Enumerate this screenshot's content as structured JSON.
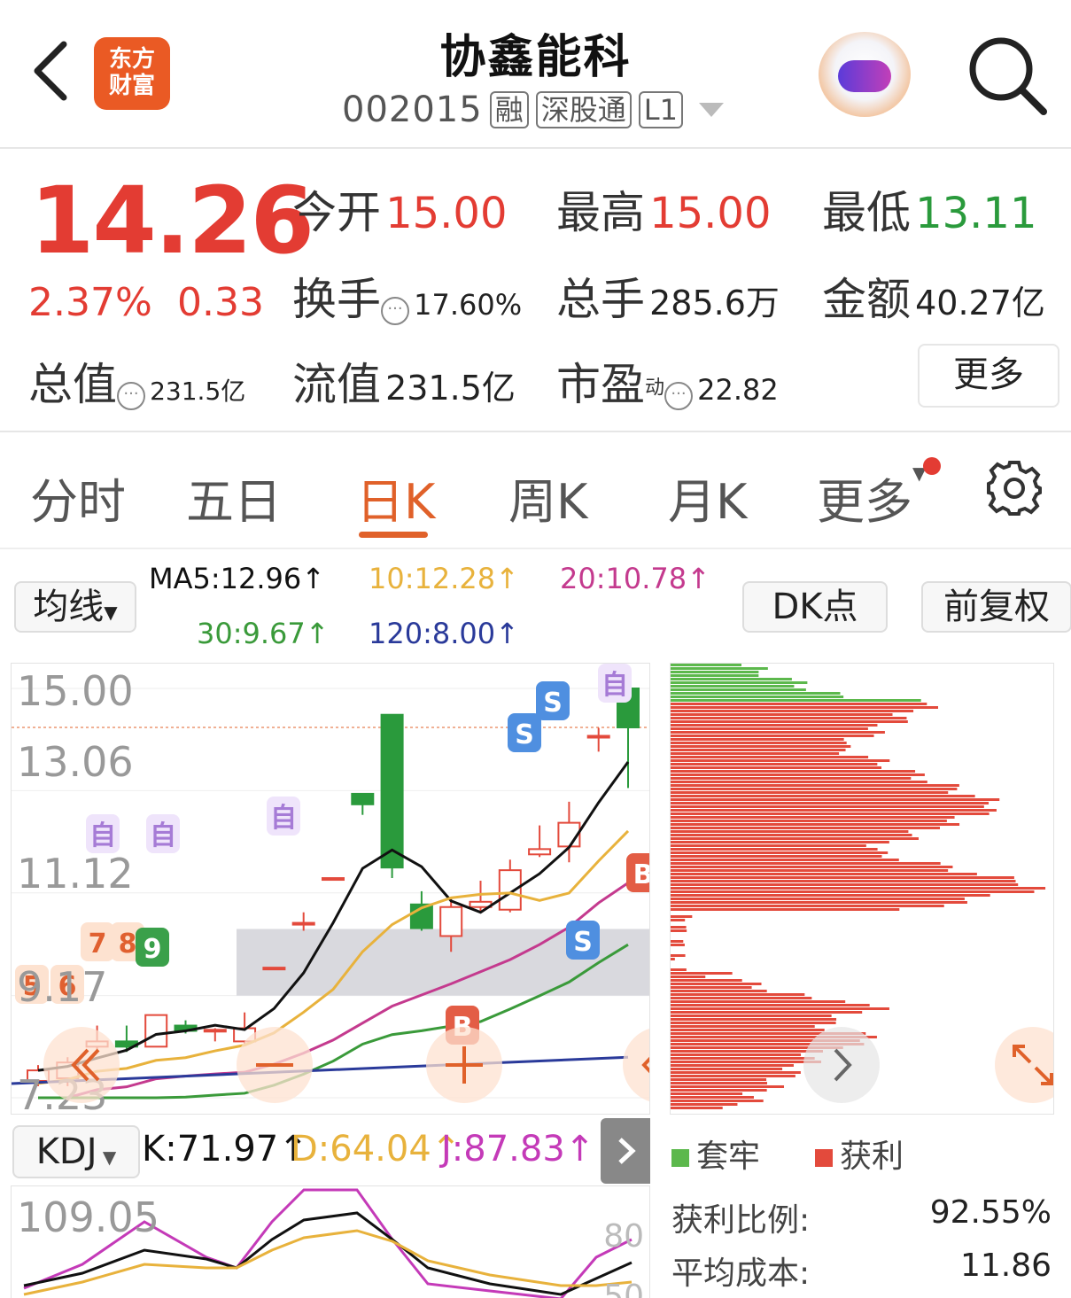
{
  "header": {
    "logo_text_line1": "东方",
    "logo_text_line2": "财富",
    "stock_name": "协鑫能科",
    "stock_code": "002015",
    "tags": [
      "融",
      "深股通",
      "L1"
    ],
    "icons": [
      "back-arrow-icon",
      "app-logo",
      "robot-assistant-icon",
      "search-icon"
    ]
  },
  "quote": {
    "price": "14.26",
    "change_pct": "2.37%",
    "change_amt": "0.33",
    "open_label": "今开",
    "open_value": "15.00",
    "high_label": "最高",
    "high_value": "15.00",
    "low_label": "最低",
    "low_value": "13.11",
    "turnover_label": "换手",
    "turnover_value": "17.60%",
    "volume_label": "总手",
    "volume_value": "285.6万",
    "amount_label": "金额",
    "amount_value": "40.27亿",
    "mktcap_label": "总值",
    "mktcap_value": "231.5亿",
    "float_label": "流值",
    "float_value": "231.5亿",
    "pe_label": "市盈",
    "pe_sup": "动",
    "pe_value": "22.82",
    "more_button": "更多",
    "colors": {
      "up": "#e33c33",
      "down": "#2a9a3c"
    }
  },
  "tabs": {
    "items": [
      "分时",
      "五日",
      "日K",
      "周K",
      "月K",
      "更多"
    ],
    "active": "日K",
    "accent": "#e0612a"
  },
  "indicators": {
    "ma_selector": "均线",
    "ma5": "MA5:12.96↑",
    "ma10": "10:12.28↑",
    "ma20": "20:10.78↑",
    "ma30": "30:9.67↑",
    "ma120": "120:8.00↑",
    "dk_button": "DK点",
    "adjust_button": "前复权",
    "colors": {
      "ma5": "#111111",
      "ma10": "#e8b23c",
      "ma20": "#c43a8e",
      "ma30": "#3a9a3a",
      "ma120": "#2a3a9a"
    }
  },
  "chart_data": {
    "type": "candlestick",
    "y_ticks": [
      "15.00",
      "13.06",
      "11.12",
      "9.17",
      "7.23"
    ],
    "ylim": [
      7.23,
      15.0
    ],
    "current_price_line": 14.26,
    "candles": [
      {
        "o": 7.55,
        "c": 7.75,
        "h": 7.85,
        "l": 7.45
      },
      {
        "o": 7.6,
        "c": 7.9,
        "h": 8.0,
        "l": 7.45
      },
      {
        "o": 8.2,
        "c": 8.3,
        "h": 8.6,
        "l": 8.1
      },
      {
        "o": 8.3,
        "c": 8.2,
        "h": 8.6,
        "l": 8.1
      },
      {
        "o": 8.2,
        "c": 8.8,
        "h": 8.8,
        "l": 8.2
      },
      {
        "o": 8.6,
        "c": 8.5,
        "h": 8.7,
        "l": 8.45
      },
      {
        "o": 8.5,
        "c": 8.52,
        "h": 8.55,
        "l": 8.3
      },
      {
        "o": 8.3,
        "c": 8.55,
        "h": 8.85,
        "l": 8.25
      },
      {
        "o": 9.7,
        "c": 9.7,
        "h": 9.7,
        "l": 9.7
      },
      {
        "o": 10.55,
        "c": 10.55,
        "h": 10.75,
        "l": 10.4
      },
      {
        "o": 11.4,
        "c": 11.4,
        "h": 11.4,
        "l": 11.4
      },
      {
        "o": 13.0,
        "c": 12.8,
        "h": 13.0,
        "l": 12.6
      },
      {
        "o": 14.5,
        "c": 11.6,
        "h": 14.5,
        "l": 11.4
      },
      {
        "o": 10.9,
        "c": 10.45,
        "h": 11.15,
        "l": 10.4
      },
      {
        "o": 10.3,
        "c": 10.85,
        "h": 11.0,
        "l": 10.0
      },
      {
        "o": 10.85,
        "c": 10.95,
        "h": 11.35,
        "l": 10.75
      },
      {
        "o": 10.8,
        "c": 11.55,
        "h": 11.75,
        "l": 10.75
      },
      {
        "o": 11.85,
        "c": 11.95,
        "h": 12.4,
        "l": 11.8
      },
      {
        "o": 12.0,
        "c": 12.45,
        "h": 12.85,
        "l": 11.7
      },
      {
        "o": 14.1,
        "c": 14.1,
        "h": 14.25,
        "l": 13.8
      },
      {
        "o": 15.0,
        "c": 14.26,
        "h": 15.0,
        "l": 13.11
      }
    ],
    "signals": [
      "自",
      "自",
      "自",
      "自",
      "S",
      "S",
      "S",
      "B",
      "B",
      "5",
      "6",
      "7",
      "8",
      "9"
    ],
    "support_zone": [
      9.17,
      10.4
    ],
    "kdj": {
      "selector": "KDJ",
      "K": "K:71.97↑",
      "D": "D:64.04↑",
      "J": "J:87.83↑",
      "y_top": "109.05",
      "ref80": "80",
      "ref50": "50"
    },
    "chip": {
      "legend_trapped": "套牢",
      "legend_profit": "获利",
      "profit_ratio_label": "获利比例:",
      "profit_ratio_value": "92.55%",
      "avg_cost_label": "平均成本:",
      "avg_cost_value": "11.86",
      "colors": {
        "trapped": "#5cb84c",
        "profit": "#e34a3c"
      }
    }
  }
}
